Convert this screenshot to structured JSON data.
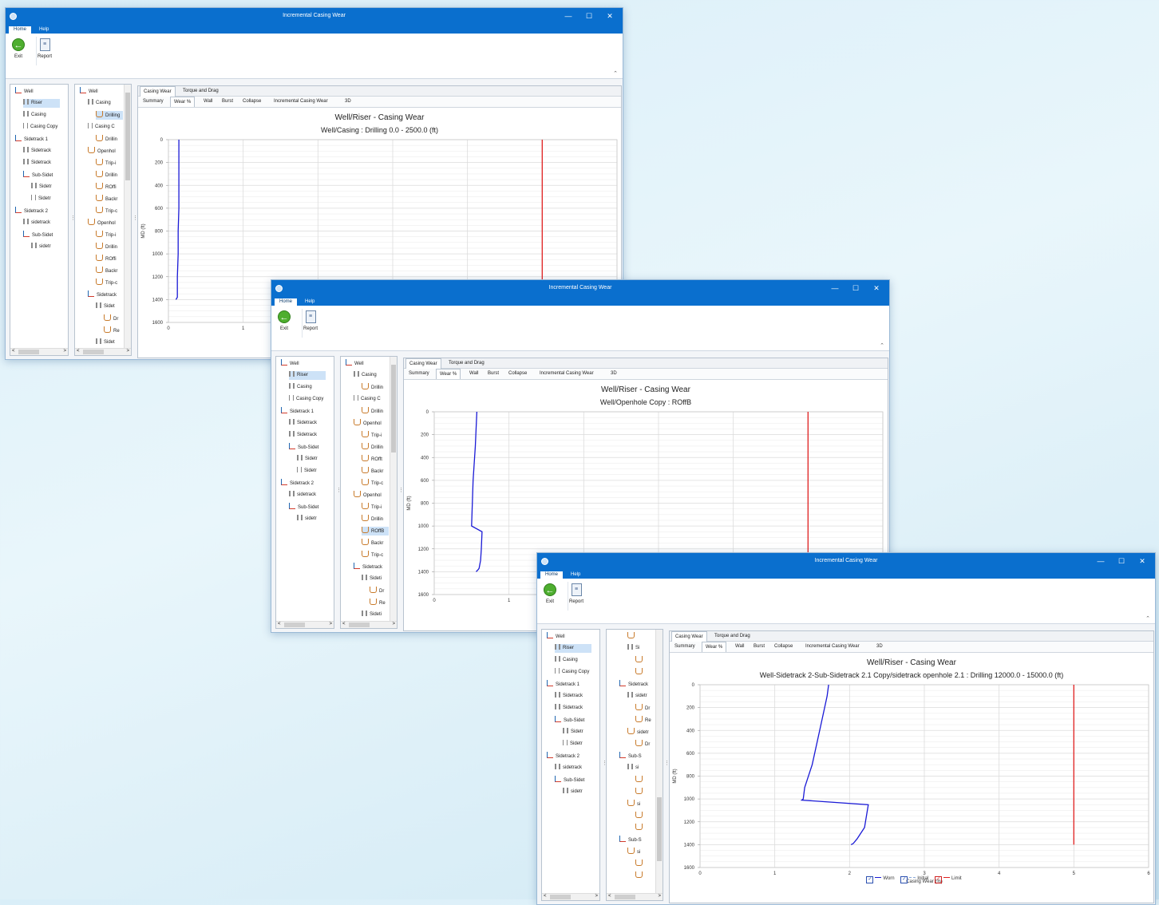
{
  "app": {
    "title": "Incremental Casing Wear",
    "menu_tabs": [
      "Home",
      "Help"
    ],
    "window_buttons": [
      "—",
      "☐",
      "✕"
    ],
    "ribbon": {
      "exit_label": "Exit",
      "report_label": "Report"
    }
  },
  "tree_left": [
    {
      "label": "Well",
      "icon": "well-icon",
      "level": 0
    },
    {
      "label": "Riser",
      "icon": "casing-icon",
      "level": 1,
      "selected": true
    },
    {
      "label": "Casing",
      "icon": "casing-icon",
      "level": 1
    },
    {
      "label": "Casing Copy",
      "icon": "fork-icon",
      "level": 1
    },
    {
      "label": "Sidetrack 1",
      "icon": "well-icon",
      "level": 0
    },
    {
      "label": "Sidetrack",
      "icon": "casing-icon",
      "level": 1
    },
    {
      "label": "Sidetrack",
      "icon": "casing-icon",
      "level": 1
    },
    {
      "label": "Sub-Sidet",
      "icon": "well-icon",
      "level": 1
    },
    {
      "label": "Sidetr",
      "icon": "casing-icon",
      "level": 2
    },
    {
      "label": "Sidetr",
      "icon": "fork-icon",
      "level": 2
    },
    {
      "label": "Sidetrack 2",
      "icon": "well-icon",
      "level": 0
    },
    {
      "label": "sidetrack",
      "icon": "casing-icon",
      "level": 1
    },
    {
      "label": "Sub-Sidet",
      "icon": "well-icon",
      "level": 1
    },
    {
      "label": "sidetr",
      "icon": "casing-icon",
      "level": 2
    }
  ],
  "tree_mid_a": [
    {
      "label": "Well",
      "icon": "well-icon",
      "level": 0
    },
    {
      "label": "Casing",
      "icon": "casing-icon",
      "level": 1
    },
    {
      "label": "Drilling",
      "icon": "open-icon",
      "level": 2,
      "selected": true
    },
    {
      "label": "Casing C",
      "icon": "fork-icon",
      "level": 1
    },
    {
      "label": "Drillin",
      "icon": "open-icon",
      "level": 2
    },
    {
      "label": "Openhol",
      "icon": "open-icon",
      "level": 1
    },
    {
      "label": "Trip-i",
      "icon": "open-icon",
      "level": 2
    },
    {
      "label": "Drillin",
      "icon": "open-icon",
      "level": 2
    },
    {
      "label": "ROffi",
      "icon": "open-icon",
      "level": 2
    },
    {
      "label": "Backr",
      "icon": "open-icon",
      "level": 2
    },
    {
      "label": "Trip-c",
      "icon": "open-icon",
      "level": 2
    },
    {
      "label": "Openhol",
      "icon": "open-icon",
      "level": 1
    },
    {
      "label": "Trip-i",
      "icon": "open-icon",
      "level": 2
    },
    {
      "label": "Drillin",
      "icon": "open-icon",
      "level": 2
    },
    {
      "label": "ROffi",
      "icon": "open-icon",
      "level": 2
    },
    {
      "label": "Backr",
      "icon": "open-icon",
      "level": 2
    },
    {
      "label": "Trip-c",
      "icon": "open-icon",
      "level": 2
    },
    {
      "label": "Sidetrack",
      "icon": "well-icon",
      "level": 1
    },
    {
      "label": "Sidet",
      "icon": "casing-icon",
      "level": 2
    },
    {
      "label": "Dr",
      "icon": "open-icon",
      "level": 3
    },
    {
      "label": "Re",
      "icon": "open-icon",
      "level": 3
    },
    {
      "label": "Sidet",
      "icon": "casing-icon",
      "level": 2
    }
  ],
  "tree_mid_b": [
    {
      "label": "Well",
      "icon": "well-icon",
      "level": 0
    },
    {
      "label": "Casing",
      "icon": "casing-icon",
      "level": 1
    },
    {
      "label": "Drillin",
      "icon": "open-icon",
      "level": 2
    },
    {
      "label": "Casing C",
      "icon": "fork-icon",
      "level": 1
    },
    {
      "label": "Drillin",
      "icon": "open-icon",
      "level": 2
    },
    {
      "label": "Openhol",
      "icon": "open-icon",
      "level": 1
    },
    {
      "label": "Trip-i",
      "icon": "open-icon",
      "level": 2
    },
    {
      "label": "Drillin",
      "icon": "open-icon",
      "level": 2
    },
    {
      "label": "ROfft",
      "icon": "open-icon",
      "level": 2
    },
    {
      "label": "Backr",
      "icon": "open-icon",
      "level": 2
    },
    {
      "label": "Trip-c",
      "icon": "open-icon",
      "level": 2
    },
    {
      "label": "Openhol",
      "icon": "open-icon",
      "level": 1
    },
    {
      "label": "Trip-i",
      "icon": "open-icon",
      "level": 2
    },
    {
      "label": "Drillin",
      "icon": "open-icon",
      "level": 2
    },
    {
      "label": "ROffB",
      "icon": "open-icon",
      "level": 2,
      "selected": true
    },
    {
      "label": "Backr",
      "icon": "open-icon",
      "level": 2
    },
    {
      "label": "Trip-c",
      "icon": "open-icon",
      "level": 2
    },
    {
      "label": "Sidetrack",
      "icon": "well-icon",
      "level": 1
    },
    {
      "label": "Sideti",
      "icon": "casing-icon",
      "level": 2
    },
    {
      "label": "Dr",
      "icon": "open-icon",
      "level": 3
    },
    {
      "label": "Re",
      "icon": "open-icon",
      "level": 3
    },
    {
      "label": "Sideti",
      "icon": "casing-icon",
      "level": 2
    }
  ],
  "tree_mid_c": [
    {
      "label": "",
      "icon": "open-icon",
      "level": 2
    },
    {
      "label": "Si",
      "icon": "casing-icon",
      "level": 2
    },
    {
      "label": "",
      "icon": "open-icon",
      "level": 3
    },
    {
      "label": "",
      "icon": "open-icon",
      "level": 3
    },
    {
      "label": "Sidetrack",
      "icon": "well-icon",
      "level": 1
    },
    {
      "label": "sidetr",
      "icon": "casing-icon",
      "level": 2
    },
    {
      "label": "Dr",
      "icon": "open-icon",
      "level": 3
    },
    {
      "label": "Re",
      "icon": "open-icon",
      "level": 3
    },
    {
      "label": "sidetr",
      "icon": "open-icon",
      "level": 2
    },
    {
      "label": "Dr",
      "icon": "open-icon",
      "level": 3
    },
    {
      "label": "Sub-S",
      "icon": "well-icon",
      "level": 1
    },
    {
      "label": "si",
      "icon": "casing-icon",
      "level": 2
    },
    {
      "label": "",
      "icon": "open-icon",
      "level": 3
    },
    {
      "label": "",
      "icon": "open-icon",
      "level": 3
    },
    {
      "label": "si",
      "icon": "open-icon",
      "level": 2
    },
    {
      "label": "",
      "icon": "open-icon",
      "level": 3
    },
    {
      "label": "",
      "icon": "open-icon",
      "level": 3
    },
    {
      "label": "Sub-S",
      "icon": "well-icon",
      "level": 1
    },
    {
      "label": "si",
      "icon": "open-icon",
      "level": 2
    },
    {
      "label": "",
      "icon": "open-icon",
      "level": 3
    },
    {
      "label": "",
      "icon": "open-icon",
      "level": 3
    }
  ],
  "content_tabs_top": [
    "Casing Wear",
    "Torque and Drag"
  ],
  "content_tabs_sub": [
    "Summary",
    "Wear %",
    "Wall",
    "Burst",
    "Collapse",
    "Incremental Casing Wear",
    "3D"
  ],
  "legend": [
    "Worn",
    "Initial",
    "Limit"
  ],
  "chart_data": [
    {
      "type": "line",
      "title": "Well/Riser - Casing Wear",
      "subtitle": "Well/Casing : Drilling 0.0 - 2500.0 (ft)",
      "ylabel": "MD (ft)",
      "xlabel": "",
      "xlim": [
        0,
        6
      ],
      "ylim": [
        0,
        1600
      ],
      "y_inverted": true,
      "x_ticks_visible": [
        0,
        1
      ],
      "y_ticks": [
        0,
        200,
        400,
        600,
        800,
        1000,
        1200,
        1400,
        1600
      ],
      "series": [
        {
          "color": "#1a1ad6",
          "x": [
            0.14,
            0.14,
            0.14,
            0.14,
            0.13,
            0.13,
            0.12,
            0.12,
            0.1
          ],
          "y": [
            0,
            200,
            400,
            600,
            800,
            1000,
            1200,
            1380,
            1400
          ]
        },
        {
          "color": "#e02020",
          "x": [
            5,
            5
          ],
          "y": [
            0,
            1400
          ]
        }
      ]
    },
    {
      "type": "line",
      "title": "Well/Riser - Casing Wear",
      "subtitle": "Well/Openhole Copy : ROffB",
      "ylabel": "MD (ft)",
      "xlabel": "",
      "xlim": [
        0,
        6
      ],
      "ylim": [
        0,
        1600
      ],
      "y_inverted": true,
      "x_ticks_visible": [
        0,
        1
      ],
      "y_ticks": [
        0,
        200,
        400,
        600,
        800,
        1000,
        1200,
        1400,
        1600
      ],
      "series": [
        {
          "color": "#1a1ad6",
          "x": [
            0.57,
            0.55,
            0.52,
            0.5,
            0.64,
            0.63,
            0.62,
            0.6,
            0.59,
            0.56
          ],
          "y": [
            0,
            300,
            600,
            1000,
            1050,
            1200,
            1300,
            1370,
            1380,
            1400
          ]
        },
        {
          "color": "#e02020",
          "x": [
            5,
            5
          ],
          "y": [
            0,
            1400
          ]
        }
      ]
    },
    {
      "type": "line",
      "title": "Well/Riser - Casing Wear",
      "subtitle": "Well-Sidetrack 2-Sub-Sidetrack 2.1 Copy/sidetrack openhole 2.1 : Drilling 12000.0 - 15000.0 (ft)",
      "ylabel": "MD (ft)",
      "xlabel": "Casing Wear (%)",
      "xlim": [
        0,
        6
      ],
      "ylim": [
        0,
        1600
      ],
      "y_inverted": true,
      "x_ticks_visible": [
        0,
        1,
        2,
        3,
        4,
        5,
        6
      ],
      "y_ticks": [
        0,
        200,
        400,
        600,
        800,
        1000,
        1200,
        1400,
        1600
      ],
      "series": [
        {
          "name": "Worn",
          "color": "#1a1ad6",
          "x": [
            1.72,
            1.7,
            1.6,
            1.5,
            1.4,
            1.38,
            1.36,
            2.25,
            2.2,
            2.1,
            2.05,
            2.02
          ],
          "y": [
            0,
            100,
            400,
            700,
            900,
            1000,
            1010,
            1050,
            1250,
            1350,
            1390,
            1400
          ]
        },
        {
          "name": "Limit",
          "color": "#e02020",
          "x": [
            5,
            5
          ],
          "y": [
            0,
            1400
          ]
        }
      ]
    }
  ]
}
